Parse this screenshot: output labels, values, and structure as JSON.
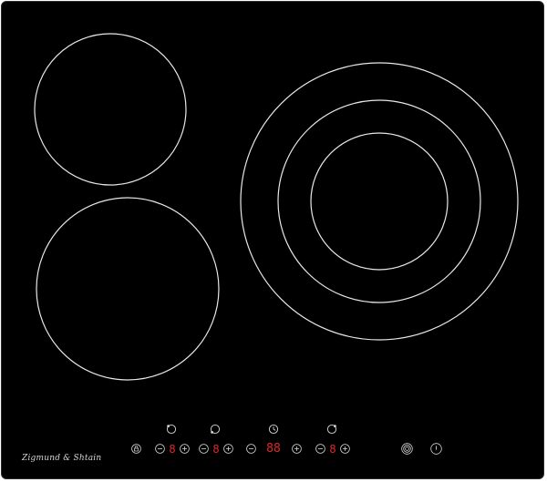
{
  "brand": {
    "name": "Zigmund & Shtain"
  },
  "zones": [
    {
      "name": "front-left",
      "min_label": "−",
      "plus_label": "+",
      "level": "8"
    },
    {
      "name": "rear-left",
      "min_label": "−",
      "plus_label": "+",
      "level": "8"
    },
    {
      "name": "timer",
      "min_label": "−",
      "plus_label": "+",
      "level": "88"
    },
    {
      "name": "right-dual",
      "min_label": "−",
      "plus_label": "+",
      "level": "8"
    }
  ],
  "icons": {
    "lock": "lock-icon",
    "zone_selectors": [
      "zone-front-left-icon",
      "zone-rear-left-icon",
      "timer-clock-icon",
      "zone-right-icon"
    ],
    "dual_circuit": "dual-circuit-icon",
    "power": "power-icon"
  },
  "colors": {
    "surface": "#000000",
    "lines": "#e8e8e8",
    "display": "#e0262b"
  }
}
